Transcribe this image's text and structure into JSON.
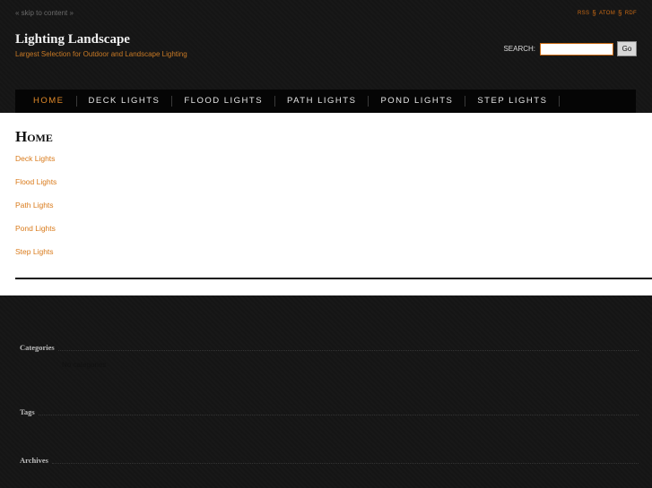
{
  "header": {
    "skip_link": "« skip to content »",
    "feeds": [
      "RSS",
      "ATOM",
      "RDF"
    ],
    "feed_sep": "§",
    "site_title": "Lighting Landscape",
    "tagline": "Largest Selection for Outdoor and Landscape Lighting",
    "search": {
      "label": "SEARCH:",
      "value": "",
      "button": "Go"
    }
  },
  "nav": {
    "items": [
      {
        "label": "HOME",
        "active": true
      },
      {
        "label": "DECK LIGHTS"
      },
      {
        "label": "FLOOD LIGHTS"
      },
      {
        "label": "PATH LIGHTS"
      },
      {
        "label": "POND LIGHTS"
      },
      {
        "label": "STEP LIGHTS"
      }
    ]
  },
  "main": {
    "title": "Home",
    "links": [
      "Deck Lights",
      "Flood Lights",
      "Path Lights",
      "Pond Lights",
      "Step Lights"
    ]
  },
  "sidebar": {
    "categories_title": "Categories",
    "no_categories": "No categories",
    "tags_title": "Tags",
    "archives_title": "Archives"
  },
  "colors": {
    "accent": "#d97a1a",
    "background": "#151515",
    "content_bg": "#ffffff"
  }
}
